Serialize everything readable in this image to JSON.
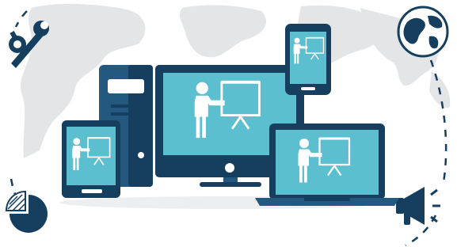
{
  "illustration": {
    "colors": {
      "background": "#ffffff",
      "map": "#e3e5e7",
      "dark_navy": "#163f5f",
      "mid_blue": "#23587f",
      "screen_blue": "#5bbfd0",
      "screen_light": "#86d3dd",
      "figure": "#ffffff",
      "shadow": "#eceef0"
    },
    "icons": [
      "world-map-background",
      "wrench-gear-icon",
      "globe-icon",
      "pie-chart-icon",
      "megaphone-icon"
    ],
    "devices": [
      "tablet",
      "desktop-tower",
      "desktop-monitor",
      "smartphone",
      "laptop"
    ],
    "screen_content": "presenter-pointing-at-board-icon"
  }
}
